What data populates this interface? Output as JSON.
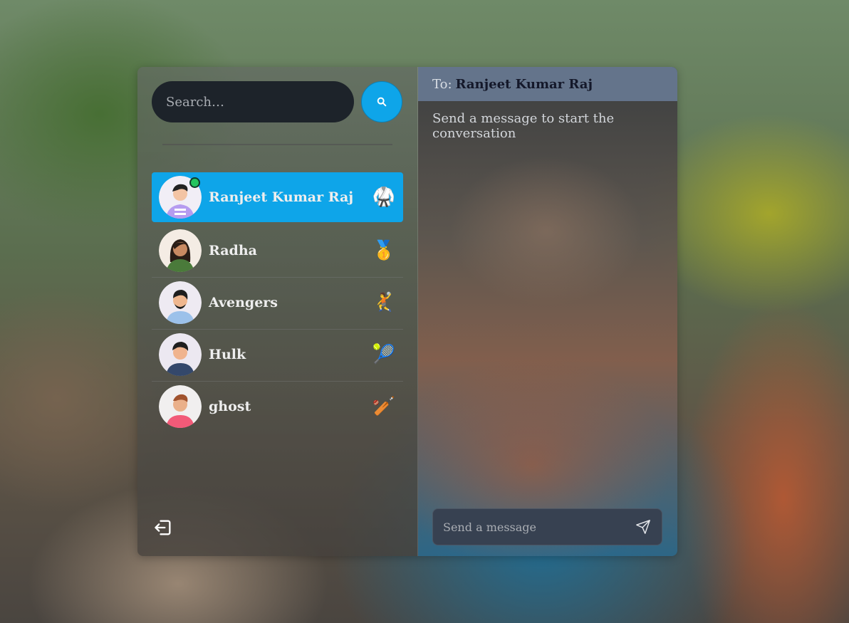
{
  "search": {
    "placeholder": "Search…"
  },
  "conversations": [
    {
      "name": "Ranjeet Kumar Raj",
      "emoji": "🥋",
      "active": true,
      "online": true
    },
    {
      "name": "Radha",
      "emoji": "🥇",
      "active": false,
      "online": false
    },
    {
      "name": "Avengers",
      "emoji": "🤾",
      "active": false,
      "online": false
    },
    {
      "name": "Hulk",
      "emoji": "🎾",
      "active": false,
      "online": false
    },
    {
      "name": "ghost",
      "emoji": "🏏",
      "active": false,
      "online": false
    }
  ],
  "chat": {
    "to_label": "To:",
    "to_name": "Ranjeet Kumar Raj",
    "empty_message": "Send a message to start the conversation",
    "input_placeholder": "Send a message"
  },
  "colors": {
    "accent": "#0ea5e9",
    "header": "#64748b",
    "online": "#22c55e"
  },
  "icons": {
    "search": "search-icon",
    "logout": "logout-icon",
    "send": "send-icon"
  }
}
